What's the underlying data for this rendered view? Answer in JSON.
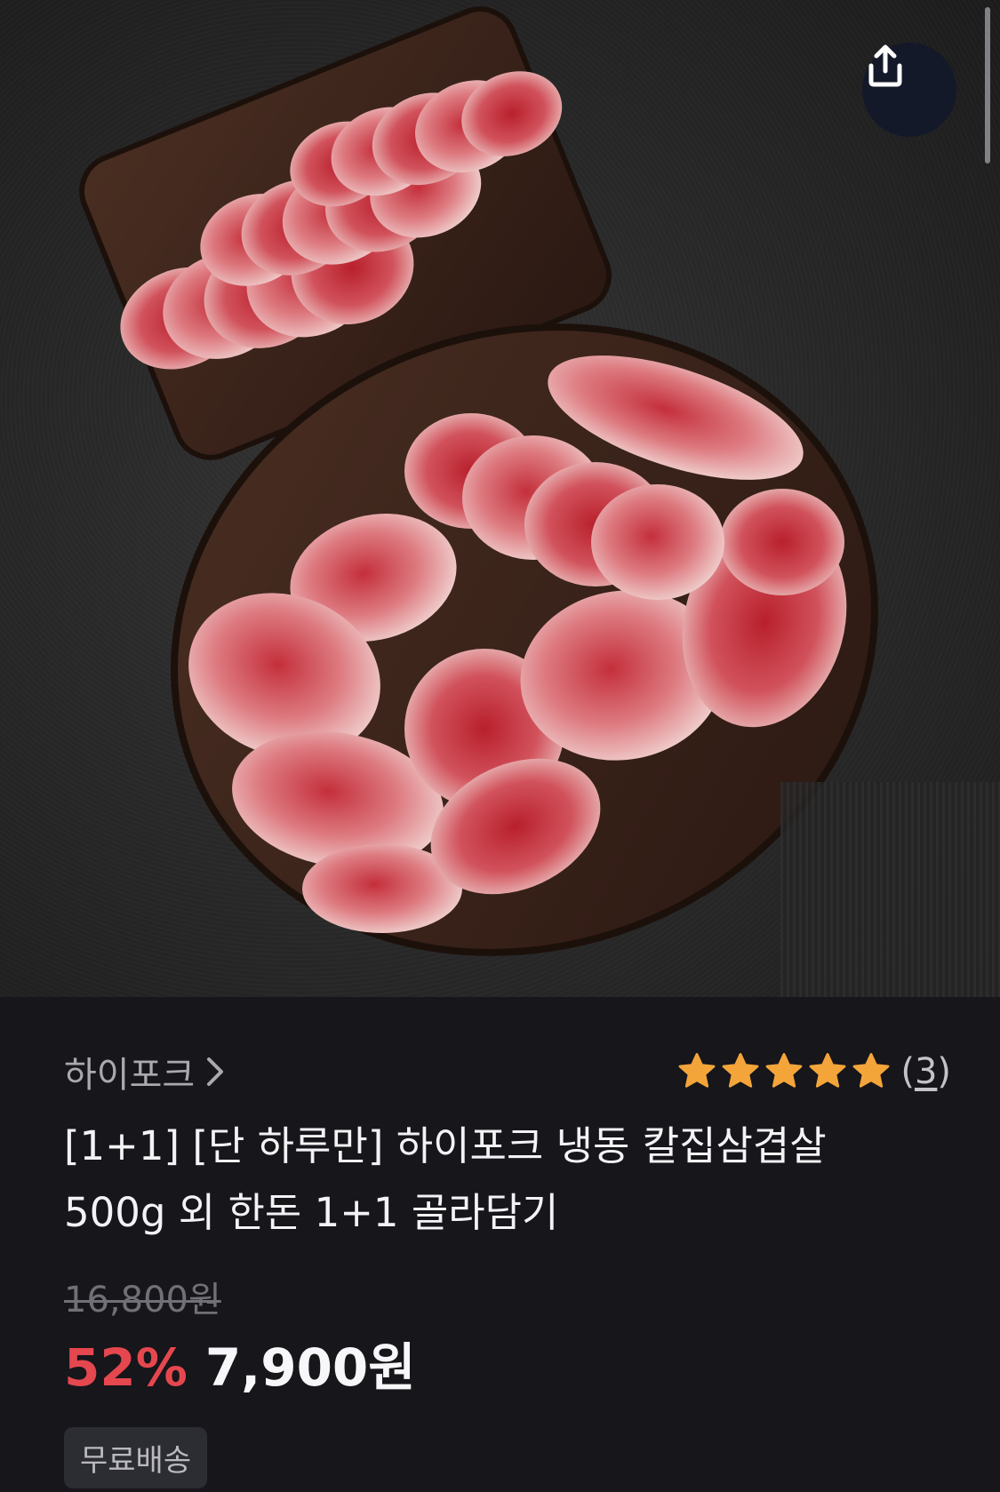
{
  "hero": {
    "image": "product-photo-pork-slices-on-wooden-trays",
    "share_icon": "share-icon"
  },
  "product": {
    "seller": "하이포크",
    "seller_chevron_icon": "chevron-right-icon",
    "rating": {
      "stars": 5,
      "star_color": "#f4a53a",
      "review_open": "(",
      "review_count": "3",
      "review_close": ")"
    },
    "title_line1": "[1+1] [단 하루만] 하이포크 냉동 칼집삼겹살",
    "title_line2": "500g 외 한돈 1+1 골라담기",
    "original_price": "16,800원",
    "discount_rate": "52%",
    "sale_price": "7,900원",
    "badge": "무료배송"
  },
  "colors": {
    "background": "#16161b",
    "discount": "#e5474f",
    "share_button": "#14192a"
  }
}
